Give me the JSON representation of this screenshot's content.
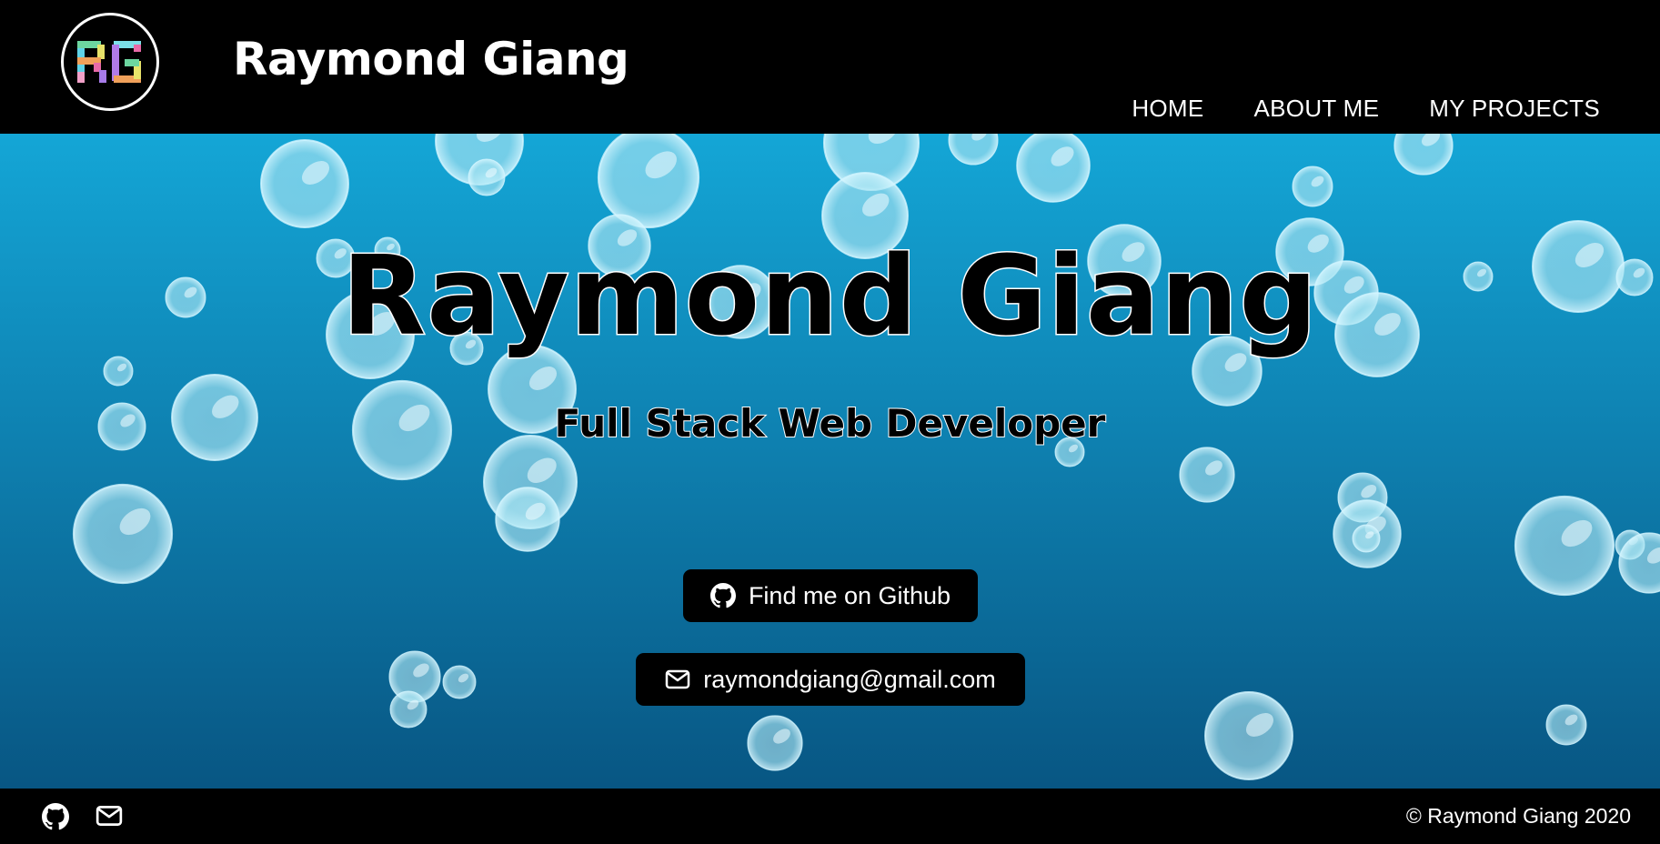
{
  "header": {
    "logo_text": "RG",
    "brand": "Raymond Giang",
    "nav": [
      "HOME",
      "ABOUT ME",
      "MY PROJECTS"
    ]
  },
  "hero": {
    "title": "Raymond Giang",
    "subtitle": "Full Stack Web Developer",
    "github_button": "Find me on Github",
    "email_button": "raymondgiang@gmail.com"
  },
  "footer": {
    "copyright": "© Raymond Giang 2020"
  },
  "colors": {
    "header_bg": "#000000",
    "hero_top": "#14a6d6",
    "hero_bottom": "#085683",
    "bubble": "#a8e4f2",
    "button_bg": "#000000"
  },
  "icons": [
    "github-icon",
    "mail-icon"
  ]
}
